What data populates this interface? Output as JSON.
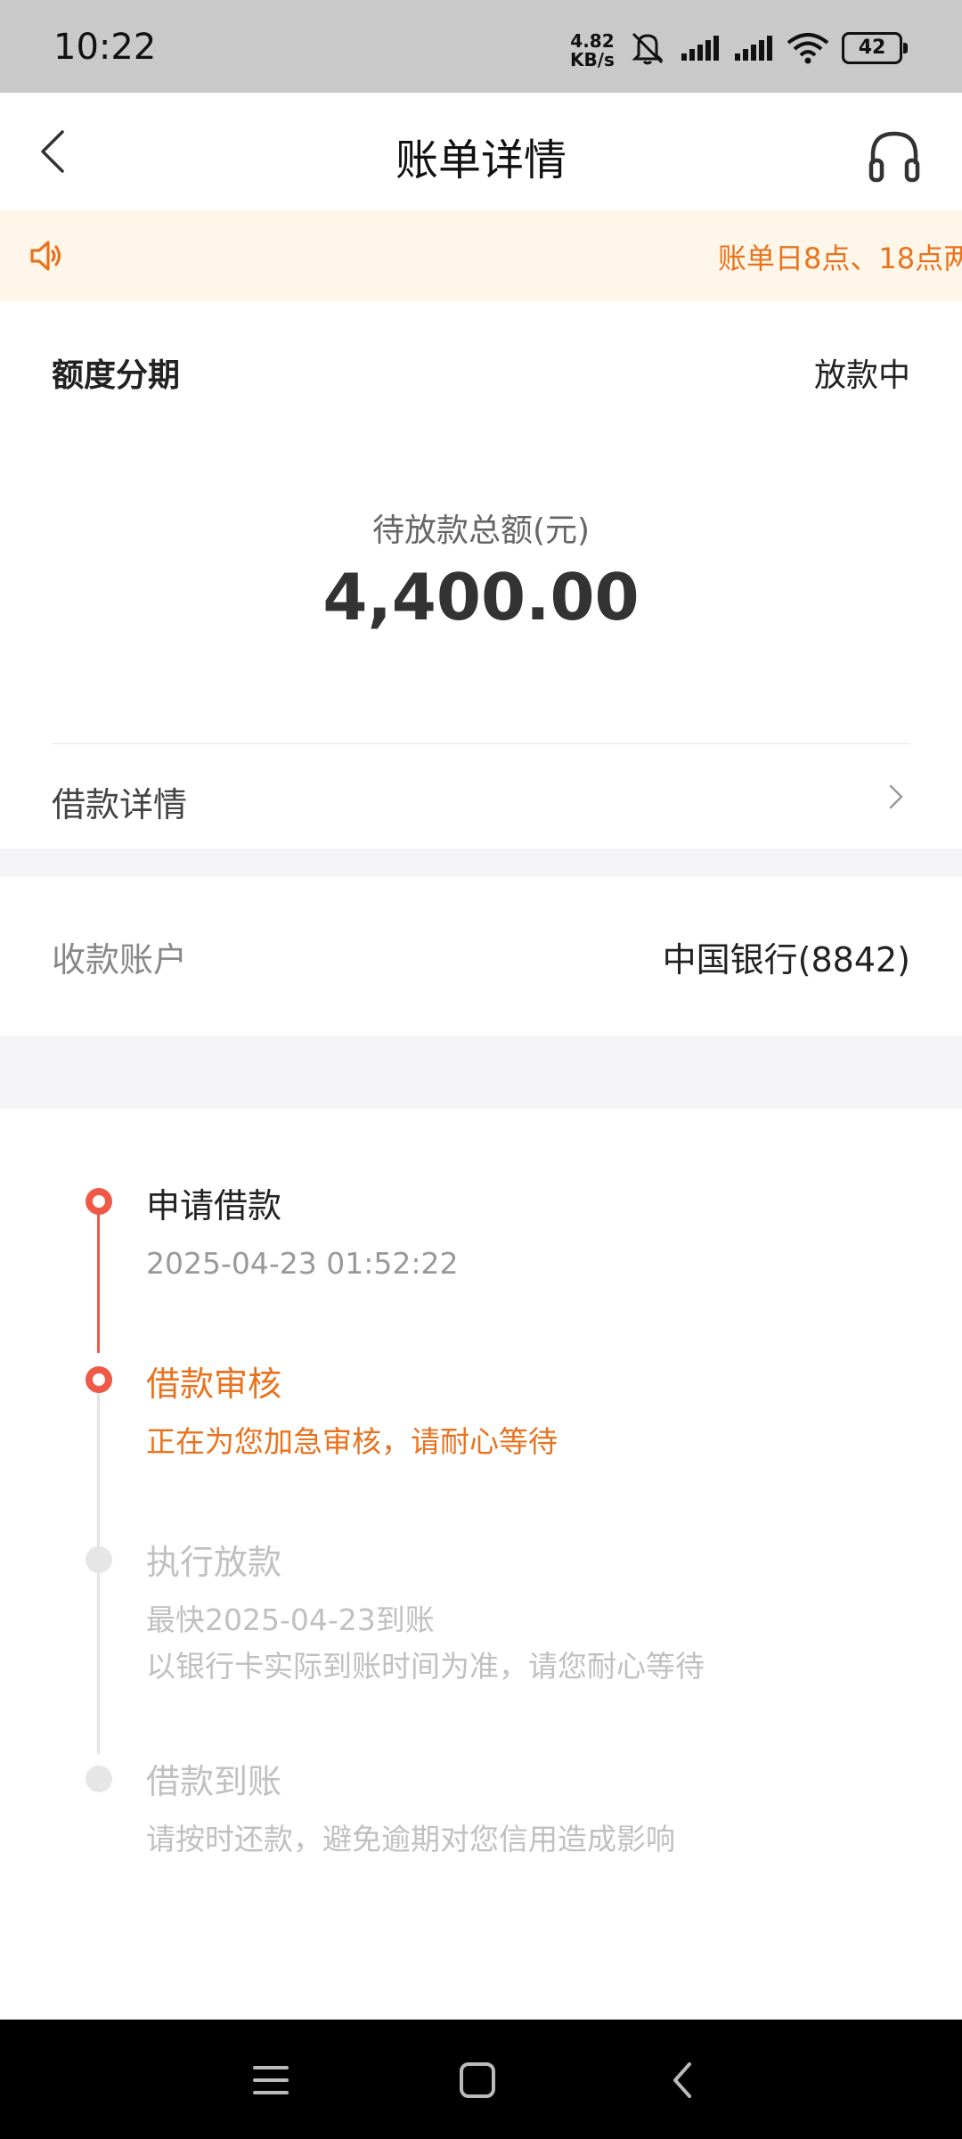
{
  "status_bar": {
    "time": "10:22",
    "net_speed_value": "4.82",
    "net_speed_unit": "KB/s",
    "battery": "42",
    "icons": [
      "mute-icon",
      "signal-icon",
      "signal-icon",
      "wifi-icon",
      "battery-icon"
    ]
  },
  "header": {
    "title": "账单详情",
    "back_icon": "back-arrow-icon",
    "service_icon": "headset-icon"
  },
  "notice": {
    "icon": "speaker-icon",
    "text": "账单日8点、18点两"
  },
  "summary": {
    "type": "额度分期",
    "status": "放款中",
    "amount_label": "待放款总额(元)",
    "amount": "4,400.00",
    "loan_details_label": "借款详情"
  },
  "account": {
    "label": "收款账户",
    "value": "中国银行(8842)"
  },
  "timeline": {
    "steps": [
      {
        "title": "申请借款",
        "desc": "2025-04-23 01:52:22",
        "state": "done"
      },
      {
        "title": "借款审核",
        "desc": "正在为您加急审核，请耐心等待",
        "state": "current"
      },
      {
        "title": "执行放款",
        "desc": "最快2025-04-23到账",
        "desc2": "以银行卡实际到账时间为准，请您耐心等待",
        "state": "pending"
      },
      {
        "title": "借款到账",
        "desc": "请按时还款，避免逾期对您信用造成影响",
        "state": "pending"
      }
    ]
  },
  "colors": {
    "accent": "#ee5a47",
    "orange_text": "#e8731f",
    "notice_bg": "#fff6ea",
    "pending": "#c0c0c0"
  },
  "system_nav": [
    "menu-icon",
    "home-icon",
    "back-icon"
  ]
}
